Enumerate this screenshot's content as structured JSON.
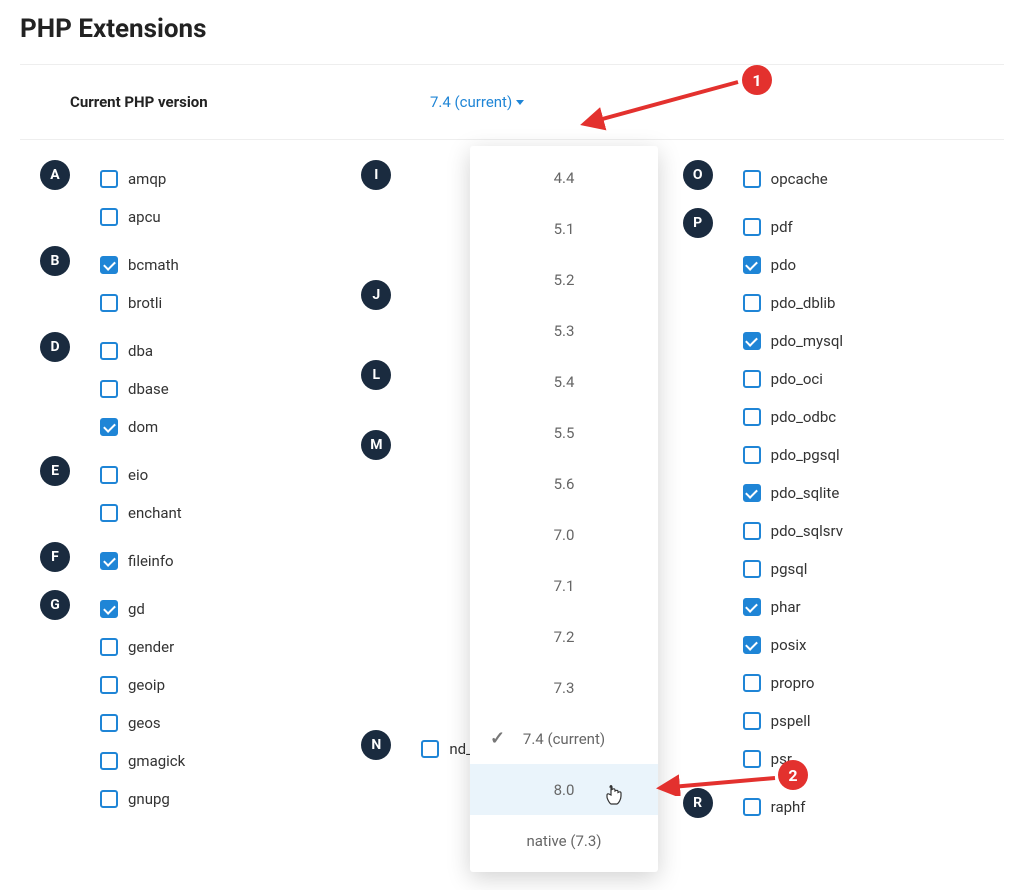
{
  "title": "PHP Extensions",
  "version_label": "Current PHP version",
  "version_value": "7.4 (current)",
  "dropdown": [
    {
      "label": "4.4"
    },
    {
      "label": "5.1"
    },
    {
      "label": "5.2"
    },
    {
      "label": "5.3"
    },
    {
      "label": "5.4"
    },
    {
      "label": "5.5"
    },
    {
      "label": "5.6"
    },
    {
      "label": "7.0"
    },
    {
      "label": "7.1"
    },
    {
      "label": "7.2"
    },
    {
      "label": "7.3"
    },
    {
      "label": "7.4 (current)",
      "current": true
    },
    {
      "label": "8.0",
      "hover": true
    },
    {
      "label": "native (7.3)"
    }
  ],
  "annotations": {
    "marker1": "1",
    "marker2": "2"
  },
  "columns": [
    [
      {
        "letter": "A",
        "items": [
          {
            "name": "amqp",
            "checked": false
          },
          {
            "name": "apcu",
            "checked": false
          }
        ]
      },
      {
        "letter": "B",
        "items": [
          {
            "name": "bcmath",
            "checked": true
          },
          {
            "name": "brotli",
            "checked": false
          }
        ]
      },
      {
        "letter": "D",
        "items": [
          {
            "name": "dba",
            "checked": false
          },
          {
            "name": "dbase",
            "checked": false
          },
          {
            "name": "dom",
            "checked": true
          }
        ]
      },
      {
        "letter": "E",
        "items": [
          {
            "name": "eio",
            "checked": false
          },
          {
            "name": "enchant",
            "checked": false
          }
        ]
      },
      {
        "letter": "F",
        "items": [
          {
            "name": "fileinfo",
            "checked": true
          }
        ]
      },
      {
        "letter": "G",
        "items": [
          {
            "name": "gd",
            "checked": true
          },
          {
            "name": "gender",
            "checked": false
          },
          {
            "name": "geoip",
            "checked": false
          },
          {
            "name": "geos",
            "checked": false
          },
          {
            "name": "gmagick",
            "checked": false
          },
          {
            "name": "gnupg",
            "checked": false
          }
        ]
      }
    ],
    [
      {
        "letter": "I",
        "spacer": 110,
        "items": []
      },
      {
        "letter": "J",
        "spacer": 70,
        "items": []
      },
      {
        "letter": "L",
        "spacer": 60,
        "items": []
      },
      {
        "letter": "M",
        "spacer": 290,
        "items": []
      },
      {
        "letter": "N",
        "items": [
          {
            "name": "nd_pdo_mysql",
            "checked": false
          }
        ]
      }
    ],
    [
      {
        "letter": "O",
        "items": [
          {
            "name": "opcache",
            "checked": false
          }
        ]
      },
      {
        "letter": "P",
        "items": [
          {
            "name": "pdf",
            "checked": false
          },
          {
            "name": "pdo",
            "checked": true
          },
          {
            "name": "pdo_dblib",
            "checked": false
          },
          {
            "name": "pdo_mysql",
            "checked": true
          },
          {
            "name": "pdo_oci",
            "checked": false
          },
          {
            "name": "pdo_odbc",
            "checked": false
          },
          {
            "name": "pdo_pgsql",
            "checked": false
          },
          {
            "name": "pdo_sqlite",
            "checked": true
          },
          {
            "name": "pdo_sqlsrv",
            "checked": false
          },
          {
            "name": "pgsql",
            "checked": false
          },
          {
            "name": "phar",
            "checked": true
          },
          {
            "name": "posix",
            "checked": true
          },
          {
            "name": "propro",
            "checked": false
          },
          {
            "name": "pspell",
            "checked": false
          },
          {
            "name": "psr",
            "checked": false
          }
        ]
      },
      {
        "letter": "R",
        "items": [
          {
            "name": "raphf",
            "checked": false
          }
        ]
      }
    ]
  ]
}
